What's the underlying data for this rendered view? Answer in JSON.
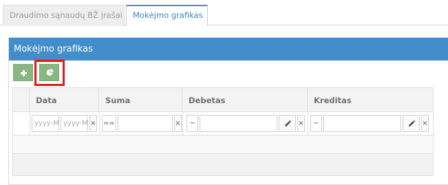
{
  "tabs": [
    {
      "label": "Draudimo sąnaudų BŽ įrašai",
      "active": false
    },
    {
      "label": "Mokėjmo grafikas",
      "active": true
    }
  ],
  "panel": {
    "title": "Mokėjmo grafikas",
    "toolbar": {
      "add_label": "+",
      "add_icon": "plus-icon",
      "chart_icon": "pie-chart-icon",
      "button_color": "#87b87f",
      "highlight_color": "#e01818"
    }
  },
  "grid": {
    "columns": [
      "",
      "Data",
      "Suma",
      "Debetas",
      "Kreditas"
    ],
    "filters": {
      "date_from_placeholder": "yyyy-MM-dd",
      "date_to_placeholder": "yyyy-MM-dd",
      "clear_symbol": "×",
      "suma_operator": "==",
      "debetas_operator": "~",
      "kreditas_operator": "~",
      "edit_icon": "pencil-icon"
    }
  },
  "colors": {
    "header_bg": "#438eca",
    "tab_active_border": "#3f8fd0"
  }
}
